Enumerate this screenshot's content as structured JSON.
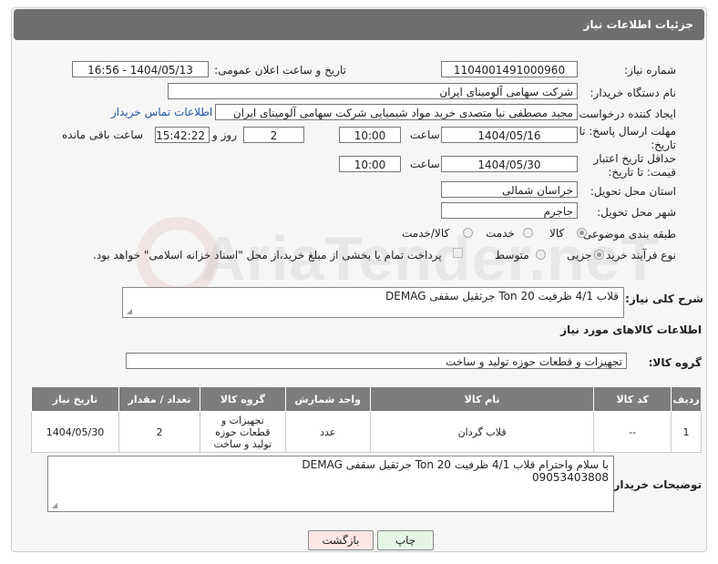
{
  "header": {
    "title": "جزئیات اطلاعات نیاز"
  },
  "fields": {
    "need_number_label": "شماره نیاز:",
    "need_number": "1104001491000960",
    "announce_label": "تاریخ و ساعت اعلان عمومی:",
    "announce_value": "1404/05/13 - 16:56",
    "buyer_org_label": "نام دستگاه خریدار:",
    "buyer_org": "شرکت سهامی آلومینای ایران",
    "creator_label": "ایجاد کننده درخواست:",
    "creator": "مجید مصطفی نیا متصدی خرید مواد شیمیایی شرکت سهامی آلومینای ایران",
    "buyer_contact_link": "اطلاعات تماس خریدار",
    "deadline_label": "مهلت ارسال پاسخ: تا تاریخ:",
    "deadline_date": "1404/05/16",
    "time_word": "ساعت",
    "deadline_time": "10:00",
    "days_count": "2",
    "days_word": "روز و",
    "remaining_time": "15:42:22",
    "remaining_word": "ساعت باقی مانده",
    "min_validity_label": "حداقل تاریخ اعتبار قیمت: تا تاریخ:",
    "validity_date": "1404/05/30",
    "validity_time": "10:00",
    "province_label": "استان محل تحویل:",
    "province": "خراسان شمالی",
    "city_label": "شهر محل تحویل:",
    "city": "جاجرم",
    "category_label": "طبقه بندی موضوعی:",
    "category_options": [
      "کالا",
      "خدمت",
      "کالا/خدمت"
    ],
    "purchase_type_label": "نوع فرآیند خرید :",
    "purchase_options": [
      "جزیی",
      "متوسط"
    ],
    "purchase_note": "پرداخت تمام یا بخشی از مبلغ خرید،از محل \"اسناد خزانه اسلامی\" خواهد بود."
  },
  "summary": {
    "label": "شرح کلی نیاز:",
    "text": "قلاب 4/1 ظرفیت 20 Ton  جرثقیل سقفی DEMAG"
  },
  "goods_section": {
    "title": "اطلاعات کالاهای مورد نیاز",
    "group_label": "گروه کالا:",
    "group_value": "تجهیزات و قطعات حوزه تولید و ساخت"
  },
  "table": {
    "headers": [
      "ردیف",
      "کد کالا",
      "نام کالا",
      "واحد شمارش",
      "گروه کالا",
      "تعداد / مقدار",
      "تاریخ نیاز"
    ],
    "rows": [
      [
        "1",
        "--",
        "قلاب گردان",
        "عدد",
        "تجهیزات و قطعات حوزه تولید و ساخت",
        "2",
        "1404/05/30"
      ]
    ]
  },
  "buyer_notes": {
    "label": "توضیحات خریدار:",
    "line1": "با سلام واحترام قلاب 4/1 ظرفیت 20 Ton  جرثقیل سقفی DEMAG",
    "line2": "09053403808"
  },
  "buttons": {
    "print": "چاپ",
    "back": "بازگشت"
  },
  "watermark": "AriaTender.neT",
  "colors": {
    "header_bg": "#6f6f6f",
    "table_header_bg": "#7d7d7d",
    "link": "#2355a6",
    "back_btn_bg": "#fde6e6",
    "print_btn_bg": "#e6f6e6"
  }
}
